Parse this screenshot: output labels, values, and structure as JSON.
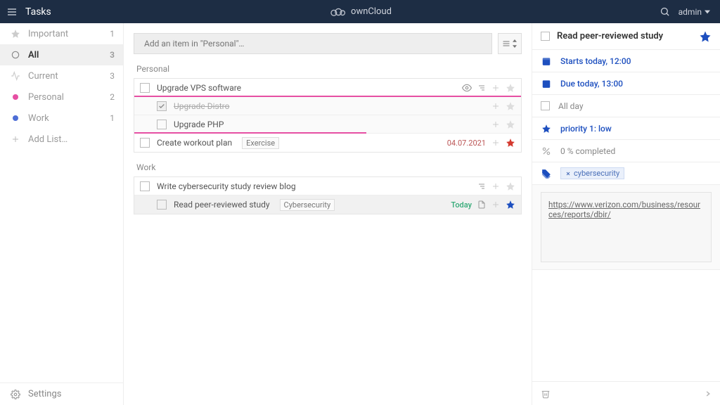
{
  "header": {
    "app_title": "Tasks",
    "brand": "ownCloud",
    "user": "admin"
  },
  "sidebar": {
    "items": [
      {
        "label": "Important",
        "count": "1"
      },
      {
        "label": "All",
        "count": "3"
      },
      {
        "label": "Current",
        "count": "3"
      },
      {
        "label": "Personal",
        "count": "2"
      },
      {
        "label": "Work",
        "count": "1"
      }
    ],
    "add_list": "Add List…",
    "settings": "Settings"
  },
  "main": {
    "add_placeholder": "Add an item in \"Personal\"…",
    "sections": {
      "personal": {
        "title": "Personal",
        "t0": "Upgrade VPS software",
        "t0a": "Upgrade Distro",
        "t0b": "Upgrade PHP",
        "t1": "Create workout plan",
        "t1_badge": "Exercise",
        "t1_date": "04.07.2021"
      },
      "work": {
        "title": "Work",
        "t0": "Write cybersecurity study review blog",
        "t1": "Read peer-reviewed study",
        "t1_badge": "Cybersecurity",
        "t1_date": "Today"
      }
    }
  },
  "panel": {
    "title": "Read peer-reviewed study",
    "start": "Starts today, 12:00",
    "due": "Due today, 13:00",
    "allday": "All day",
    "priority": "priority 1: low",
    "progress": "0 % completed",
    "tag": "cybersecurity",
    "note_url": "https://www.verizon.com/business/resources/reports/dbir/"
  }
}
